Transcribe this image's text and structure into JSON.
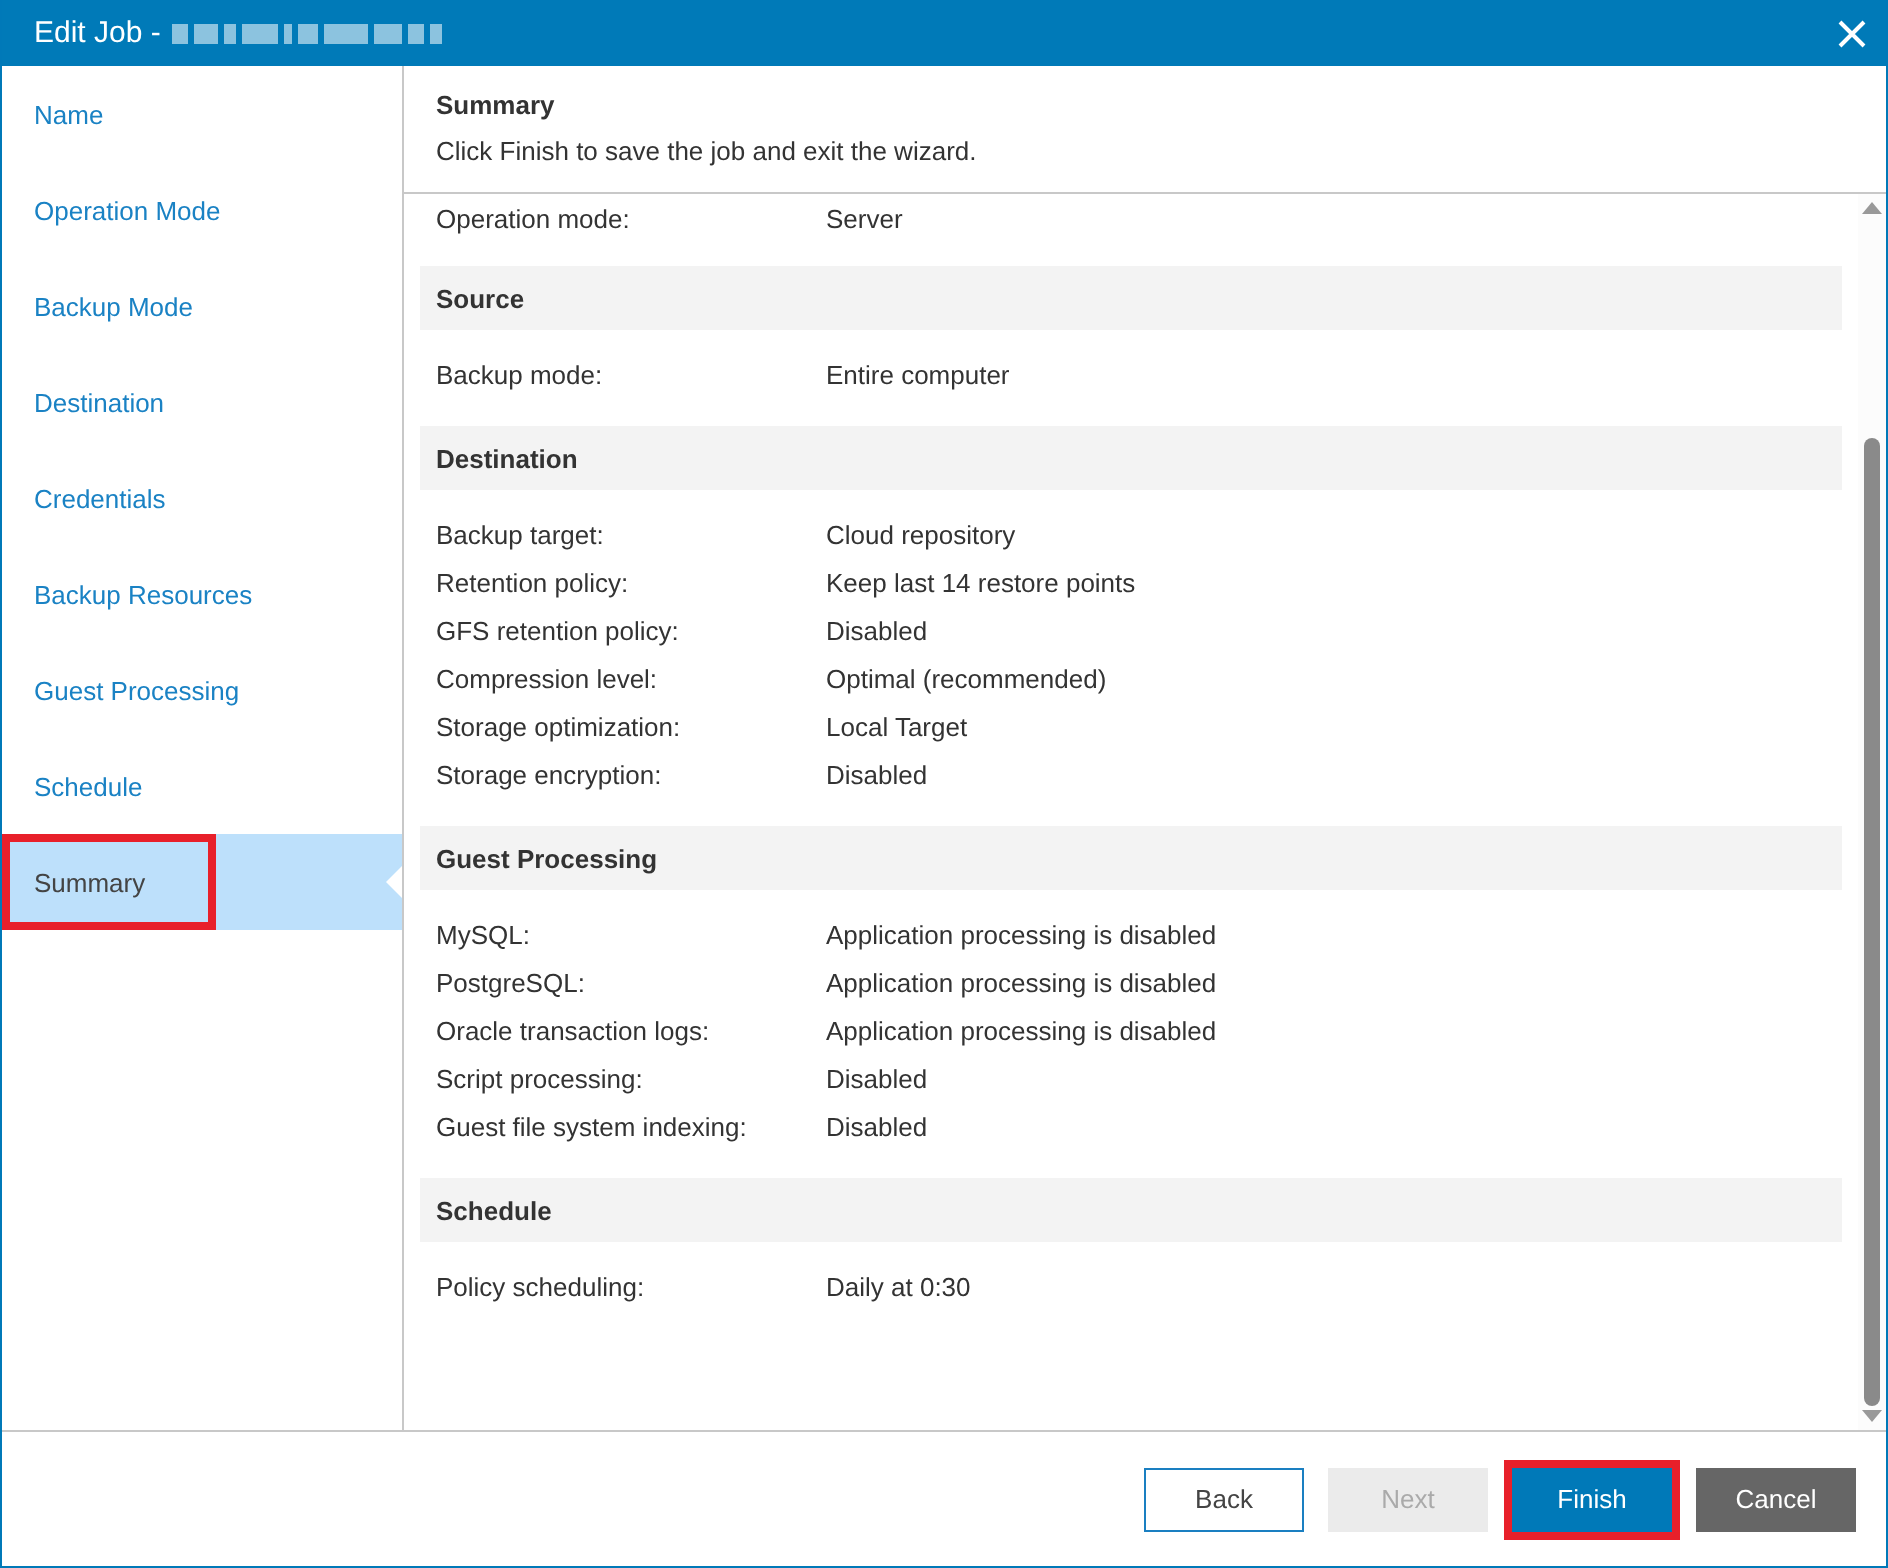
{
  "window": {
    "title": "Edit Job -",
    "title_redacted": true
  },
  "sidebar": {
    "items": [
      {
        "label": "Name",
        "selected": false,
        "highlighted": false
      },
      {
        "label": "Operation Mode",
        "selected": false,
        "highlighted": false
      },
      {
        "label": "Backup Mode",
        "selected": false,
        "highlighted": false
      },
      {
        "label": "Destination",
        "selected": false,
        "highlighted": false
      },
      {
        "label": "Credentials",
        "selected": false,
        "highlighted": false
      },
      {
        "label": "Backup Resources",
        "selected": false,
        "highlighted": false
      },
      {
        "label": "Guest Processing",
        "selected": false,
        "highlighted": false
      },
      {
        "label": "Schedule",
        "selected": false,
        "highlighted": false
      },
      {
        "label": "Summary",
        "selected": true,
        "highlighted": true
      }
    ]
  },
  "header": {
    "title": "Summary",
    "subtitle": "Click Finish to save the job and exit the wizard."
  },
  "summary": {
    "leading_rows": [
      {
        "label": "Operation mode:",
        "value": "Server"
      }
    ],
    "sections": [
      {
        "title": "Source",
        "rows": [
          {
            "label": "Backup mode:",
            "value": "Entire computer"
          }
        ]
      },
      {
        "title": "Destination",
        "rows": [
          {
            "label": "Backup target:",
            "value": "Cloud repository"
          },
          {
            "label": "Retention policy:",
            "value": "Keep last 14 restore points"
          },
          {
            "label": "GFS retention policy:",
            "value": "Disabled"
          },
          {
            "label": "Compression level:",
            "value": "Optimal (recommended)"
          },
          {
            "label": "Storage optimization:",
            "value": "Local Target"
          },
          {
            "label": "Storage encryption:",
            "value": "Disabled"
          }
        ]
      },
      {
        "title": "Guest Processing",
        "rows": [
          {
            "label": "MySQL:",
            "value": "Application processing is disabled"
          },
          {
            "label": "PostgreSQL:",
            "value": "Application processing is disabled"
          },
          {
            "label": "Oracle transaction logs:",
            "value": "Application processing is disabled"
          },
          {
            "label": "Script processing:",
            "value": "Disabled"
          },
          {
            "label": "Guest file system indexing:",
            "value": "Disabled"
          }
        ]
      },
      {
        "title": "Schedule",
        "rows": [
          {
            "label": "Policy scheduling:",
            "value": "Daily at 0:30"
          }
        ]
      }
    ]
  },
  "buttons": [
    {
      "label": "Back",
      "kind": "outline",
      "disabled": false,
      "highlighted": false
    },
    {
      "label": "Next",
      "kind": "outline",
      "disabled": true,
      "highlighted": false
    },
    {
      "label": "Finish",
      "kind": "primary",
      "disabled": false,
      "highlighted": true
    },
    {
      "label": "Cancel",
      "kind": "dark",
      "disabled": false,
      "highlighted": false
    }
  ]
}
